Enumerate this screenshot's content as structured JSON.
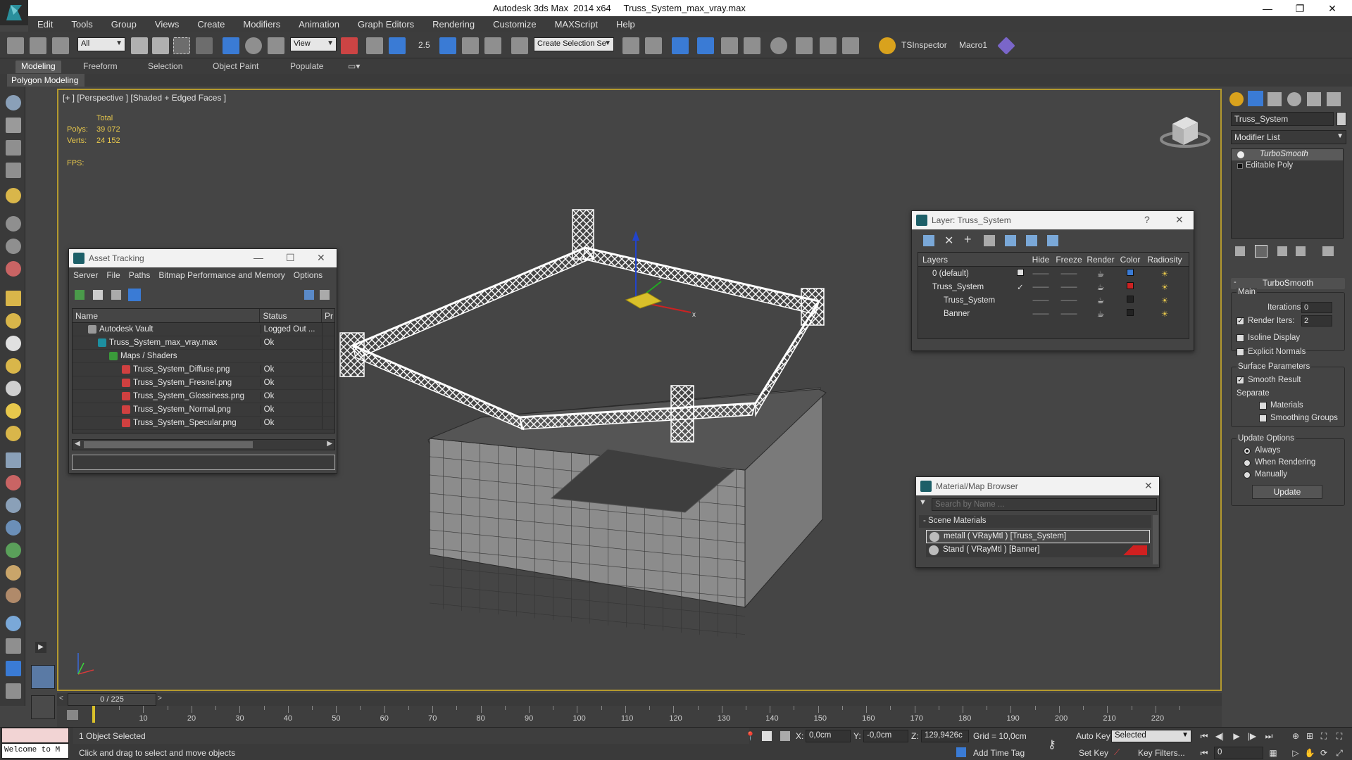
{
  "window": {
    "title": "Autodesk 3ds Max  2014 x64     Truss_System_max_vray.max",
    "minimize": "—",
    "restore": "❐",
    "close": "✕"
  },
  "menu": [
    "Edit",
    "Tools",
    "Group",
    "Views",
    "Create",
    "Modifiers",
    "Animation",
    "Graph Editors",
    "Rendering",
    "Customize",
    "MAXScript",
    "Help"
  ],
  "toolbar": {
    "filter_combo": "All",
    "refcoord_combo": "View",
    "snap_label": "2.5",
    "selection_set": "Create Selection Se",
    "tsinspector": "TSInspector",
    "macro1": "Macro1"
  },
  "ribbon": {
    "tabs": [
      "Modeling",
      "Freeform",
      "Selection",
      "Object Paint",
      "Populate"
    ],
    "active_tab": "Modeling",
    "subpanel": "Polygon Modeling"
  },
  "viewport": {
    "label": "[+ ] [Perspective ] [Shaded + Edged Faces ]",
    "stats": {
      "total_label": "Total",
      "polys_label": "Polys:",
      "polys_value": "39 072",
      "verts_label": "Verts:",
      "verts_value": "24 152",
      "fps_label": "FPS:"
    },
    "axis_x": "x",
    "axis_y": "y"
  },
  "asset_tracking": {
    "title": "Asset Tracking",
    "menu": [
      "Server",
      "File",
      "Paths",
      "Bitmap Performance and Memory",
      "Options"
    ],
    "columns": [
      "Name",
      "Status",
      "Pr"
    ],
    "rows": [
      {
        "name": "Autodesk Vault",
        "status": "Logged Out ...",
        "indent": 0
      },
      {
        "name": "Truss_System_max_vray.max",
        "status": "Ok",
        "indent": 1
      },
      {
        "name": "Maps / Shaders",
        "status": "",
        "indent": 2
      },
      {
        "name": "Truss_System_Diffuse.png",
        "status": "Ok",
        "indent": 3
      },
      {
        "name": "Truss_System_Fresnel.png",
        "status": "Ok",
        "indent": 3
      },
      {
        "name": "Truss_System_Glossiness.png",
        "status": "Ok",
        "indent": 3
      },
      {
        "name": "Truss_System_Normal.png",
        "status": "Ok",
        "indent": 3
      },
      {
        "name": "Truss_System_Specular.png",
        "status": "Ok",
        "indent": 3
      }
    ]
  },
  "layer_dialog": {
    "title": "Layer: Truss_System",
    "help": "?",
    "columns": [
      "Layers",
      "Hide",
      "Freeze",
      "Render",
      "Color",
      "Radiosity"
    ],
    "rows": [
      {
        "name": "0 (default)",
        "color": "#3a7bd5",
        "indent": 0
      },
      {
        "name": "Truss_System",
        "color": "#cc2222",
        "indent": 0
      },
      {
        "name": "Truss_System",
        "color": "#222222",
        "indent": 1
      },
      {
        "name": "Banner",
        "color": "#222222",
        "indent": 1
      }
    ]
  },
  "material_browser": {
    "title": "Material/Map Browser",
    "search_placeholder": "Search by Name ...",
    "section": "Scene Materials",
    "items": [
      "metall  ( VRayMtl ) [Truss_System]",
      "Stand  ( VRayMtl ) [Banner]"
    ]
  },
  "command_panel": {
    "object_name": "Truss_System",
    "modifier_list": "Modifier List",
    "stack": [
      "TurboSmooth",
      "Editable Poly"
    ],
    "rollout_title": "TurboSmooth",
    "main_label": "Main",
    "iterations_label": "Iterations:",
    "iterations_value": "0",
    "render_iters_label": "Render Iters:",
    "render_iters_value": "2",
    "isoline_label": "Isoline Display",
    "explicit_normals_label": "Explicit Normals",
    "surface_label": "Surface Parameters",
    "smooth_result_label": "Smooth Result",
    "separate_label": "Separate",
    "materials_label": "Materials",
    "smoothing_groups_label": "Smoothing Groups",
    "update_options_label": "Update Options",
    "always_label": "Always",
    "when_rendering_label": "When Rendering",
    "manually_label": "Manually",
    "update_button": "Update"
  },
  "timeline": {
    "frame_display": "0 / 225",
    "ticks": [
      "10",
      "20",
      "30",
      "40",
      "50",
      "60",
      "70",
      "80",
      "90",
      "100",
      "110",
      "120",
      "130",
      "140",
      "150",
      "160",
      "170",
      "180",
      "190",
      "200",
      "210",
      "220"
    ]
  },
  "status": {
    "welcome": "Welcome to M",
    "selected_text": "1 Object Selected",
    "prompt": "Click and drag to select and move objects",
    "x_label": "X:",
    "x_value": "0,0cm",
    "y_label": "Y:",
    "y_value": "-0,0cm",
    "z_label": "Z:",
    "z_value": "129,9426c",
    "grid": "Grid = 10,0cm",
    "add_time_tag": "Add Time Tag",
    "auto_key": "Auto Key",
    "set_key": "Set Key",
    "selected_combo": "Selected",
    "key_filters": "Key Filters...",
    "frame_field": "0"
  },
  "colors": {
    "viewport_border": "#b49a2e",
    "stats_text": "#e8c84c",
    "truss": "#ffffff",
    "stand_side": "#8a8a8a"
  }
}
